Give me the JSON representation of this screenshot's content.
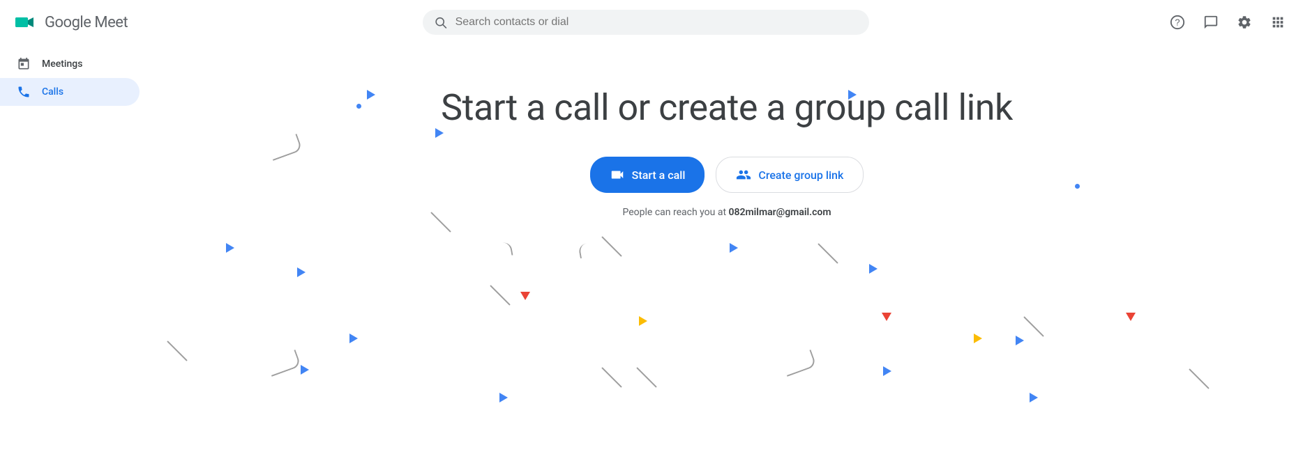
{
  "app": {
    "name": "Google Meet",
    "logo_alt": "Google Meet"
  },
  "header": {
    "search_placeholder": "Search contacts or dial",
    "help_icon": "?",
    "feedback_icon": "💬",
    "settings_icon": "⚙"
  },
  "sidebar": {
    "items": [
      {
        "id": "meetings",
        "label": "Meetings",
        "icon": "calendar"
      },
      {
        "id": "calls",
        "label": "Calls",
        "icon": "phone",
        "active": true
      }
    ]
  },
  "main": {
    "title": "Start a call or create a group call link",
    "start_call_button": "Start a call",
    "create_group_link_button": "Create group link",
    "reach_text": "People can reach you at",
    "reach_email": "082milmar@gmail.com"
  }
}
